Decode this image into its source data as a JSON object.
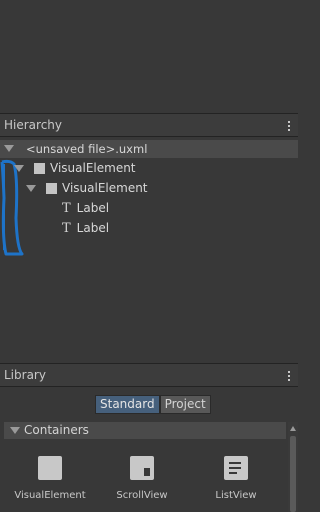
{
  "hierarchy": {
    "title": "Hierarchy",
    "file": "<unsaved file>.uxml",
    "items": [
      {
        "label": "VisualElement",
        "type": "visual-element"
      },
      {
        "label": "VisualElement",
        "type": "visual-element"
      },
      {
        "label": "Label",
        "type": "label"
      },
      {
        "label": "Label",
        "type": "label"
      }
    ],
    "label_glyph": "T"
  },
  "library": {
    "title": "Library",
    "tabs": [
      "Standard",
      "Project"
    ],
    "active_tab": "Standard",
    "category": "Containers",
    "items": [
      "VisualElement",
      "ScrollView",
      "ListView"
    ]
  },
  "colors": {
    "background": "#383838",
    "header": "#3c3c3c",
    "selection_outline": "#1e73c8",
    "active_tab": "#46607c"
  }
}
